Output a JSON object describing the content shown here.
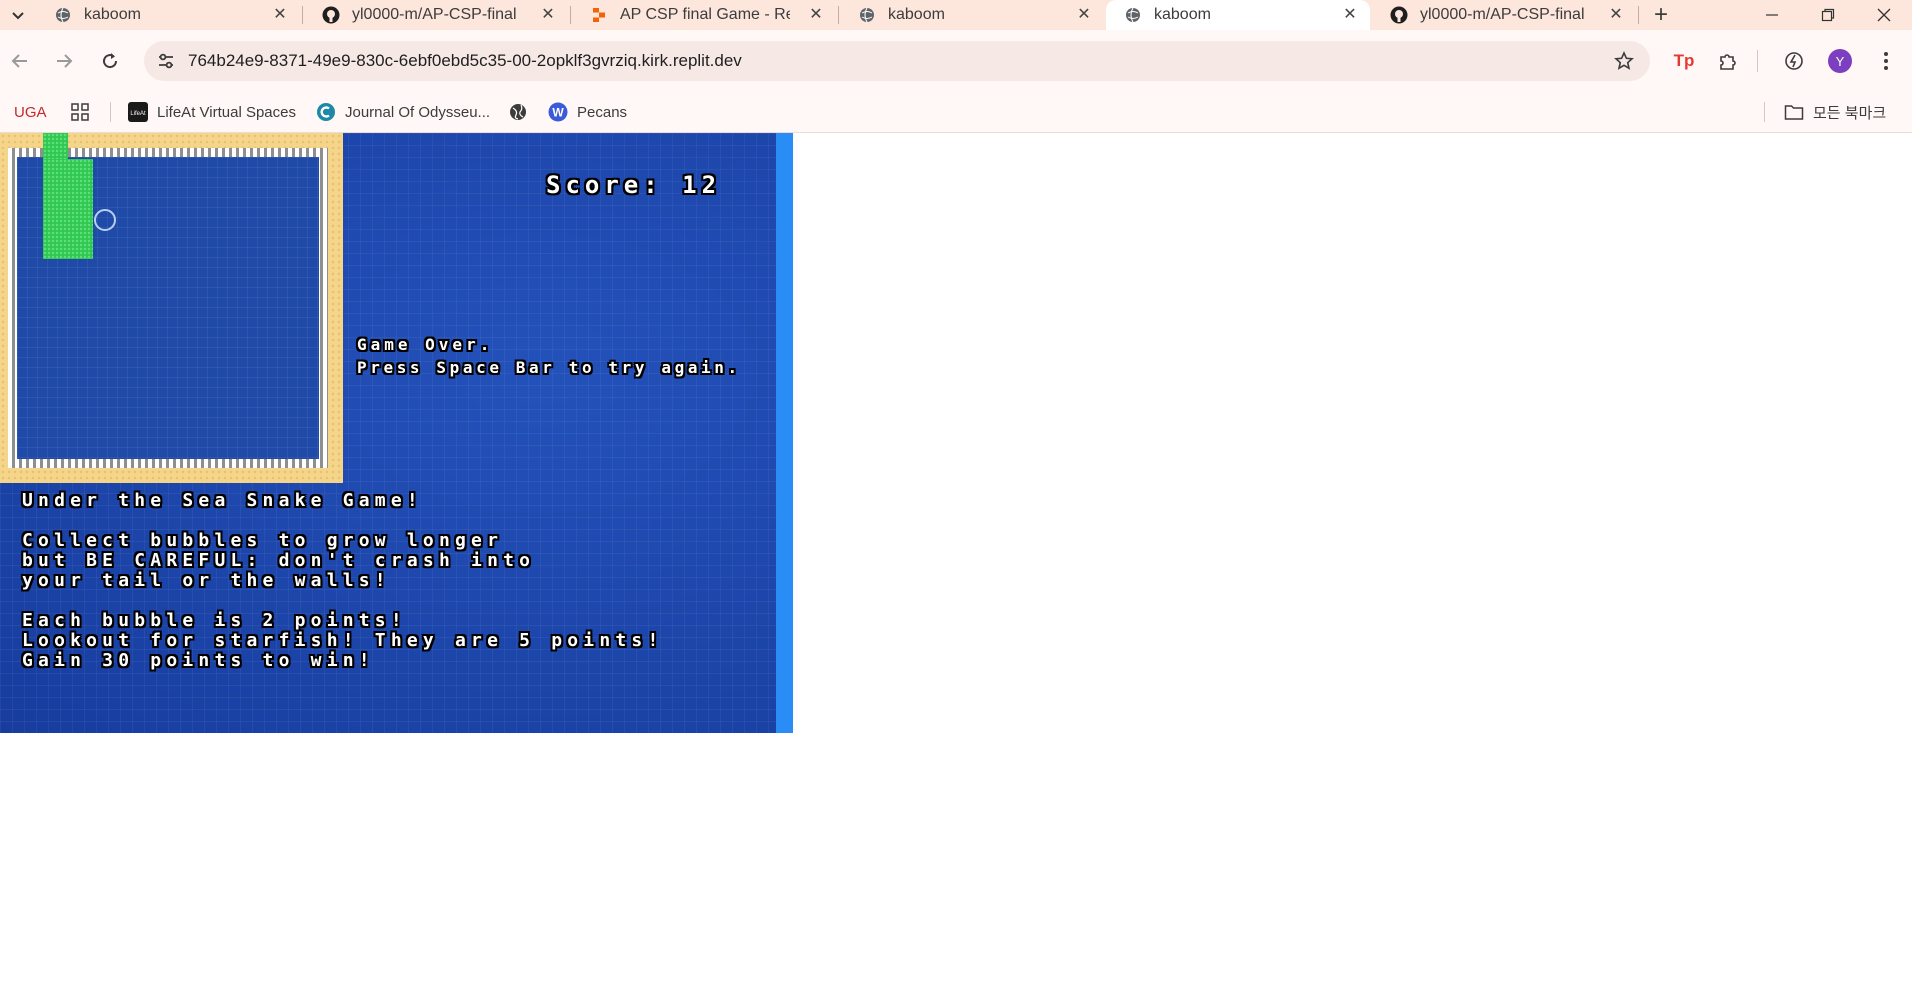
{
  "browser": {
    "tabs": [
      {
        "title": "kaboom",
        "icon": "globe-icon",
        "active": false
      },
      {
        "title": "yl0000-m/AP-CSP-final",
        "icon": "github-icon",
        "active": false
      },
      {
        "title": "AP CSP final Game - Repl",
        "icon": "replit-icon",
        "active": false
      },
      {
        "title": "kaboom",
        "icon": "globe-icon",
        "active": false
      },
      {
        "title": "kaboom",
        "icon": "globe-icon",
        "active": true
      },
      {
        "title": "yl0000-m/AP-CSP-final",
        "icon": "github-icon",
        "active": false
      }
    ],
    "url": "764b24e9-8371-49e9-830c-6ebf0ebd5c35-00-2opklf3gvrziq.kirk.replit.dev",
    "profile_initial": "Y",
    "extension_label": "Tp",
    "bookmarks": [
      {
        "label": "UGA",
        "icon": "none"
      },
      {
        "label": "",
        "icon": "apps-grid-icon"
      },
      {
        "label": "LifeAt Virtual Spaces",
        "icon": "lifeat-icon"
      },
      {
        "label": "Journal Of Odysseu...",
        "icon": "c-logo-icon"
      },
      {
        "label": "",
        "icon": "globe-icon"
      },
      {
        "label": "Pecans",
        "icon": "w-logo-icon"
      }
    ],
    "all_bookmarks_label": "모든 북마크"
  },
  "game": {
    "score_text": "Score: 12",
    "game_over_line1": "Game Over.",
    "game_over_line2": "Press Space Bar to try again.",
    "instructions": {
      "title": "Under the Sea Snake Game!",
      "line1": "Collect bubbles to grow longer",
      "line2": "but BE CAREFUL: don't crash into",
      "line3": "your tail or the walls!",
      "line4": "Each bubble is 2 points!",
      "line5": "Lookout for starfish! They are 5 points!",
      "line6": "Gain 30 points to win!"
    }
  },
  "colors": {
    "tabstrip": "#fde6dc",
    "ocean": "#1d45a6",
    "snake": "#2fc750",
    "sand": "#f5d58a",
    "profile": "#7b3fbf"
  }
}
